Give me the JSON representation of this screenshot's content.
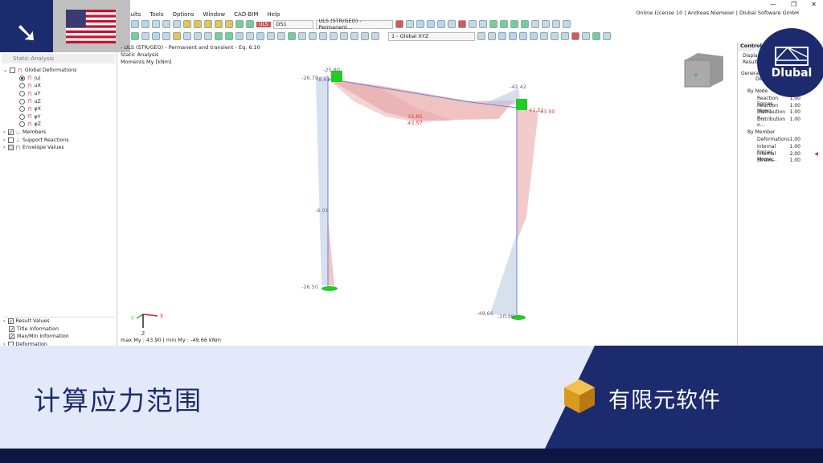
{
  "menu": [
    "Results",
    "Tools",
    "Options",
    "Window",
    "CAD-BIM",
    "Help"
  ],
  "license": "Online License 10 | Andreas Niemeier | Dlubal Software GmbH",
  "toolbar": {
    "uls_badge": "ULS",
    "ds": "DS1",
    "combo": "ULS (STR/GEO) - Permanent...",
    "view": "1 - Global XYZ"
  },
  "left_panel": {
    "title": "Static Analysis",
    "items": [
      "Global Deformations",
      "|u|",
      "uX",
      "uY",
      "uZ",
      "φX",
      "φY",
      "φZ",
      "Members",
      "Support Reactions",
      "Envelope Values"
    ],
    "bottom": [
      "Result Values",
      "Title Information",
      "Max/Min Information",
      "Deformation"
    ]
  },
  "view": {
    "line1": "- ULS (STR/GEO) - Permanent and transient - Eq. 6.10",
    "line2": "Static Analysis",
    "line3": "Moments My [kNm]",
    "maxmin": "max My : 43.90 | min My : -49.66 kNm",
    "labels": {
      "a": "-25.80",
      "b": "-26.79",
      "c": "-8.61",
      "d": "-42.42",
      "e": "33.65",
      "f": "43.57",
      "g": "41.51",
      "h": "43.90",
      "i": "-6.01",
      "j": "-26.50",
      "k": "-49.66",
      "l": "-10.29"
    },
    "axes": {
      "x": "X",
      "y": "Y",
      "z": "Z"
    },
    "cube": "-Y"
  },
  "control_panel": {
    "title": "Control Panel",
    "display": "Display",
    "results": "Results",
    "general": "General",
    "general_item": "Deformation",
    "by_node": "By Node",
    "node_items": [
      [
        "Reaction Forces",
        "1.00"
      ],
      [
        "Reaction Mom...",
        "1.00"
      ],
      [
        "Distribution o...",
        "1.00"
      ],
      [
        "Distribution o...",
        "1.00"
      ]
    ],
    "by_member": "By Member",
    "member_items": [
      [
        "Deformations",
        "1.00"
      ],
      [
        "Internal Forces",
        "1.00"
      ],
      [
        "Internal Mome...",
        "2.00"
      ],
      [
        "Strains",
        "1.00"
      ]
    ]
  },
  "brand": "Dlubal",
  "banner": {
    "title": "计算应力范围",
    "subtitle": "有限元软件"
  }
}
